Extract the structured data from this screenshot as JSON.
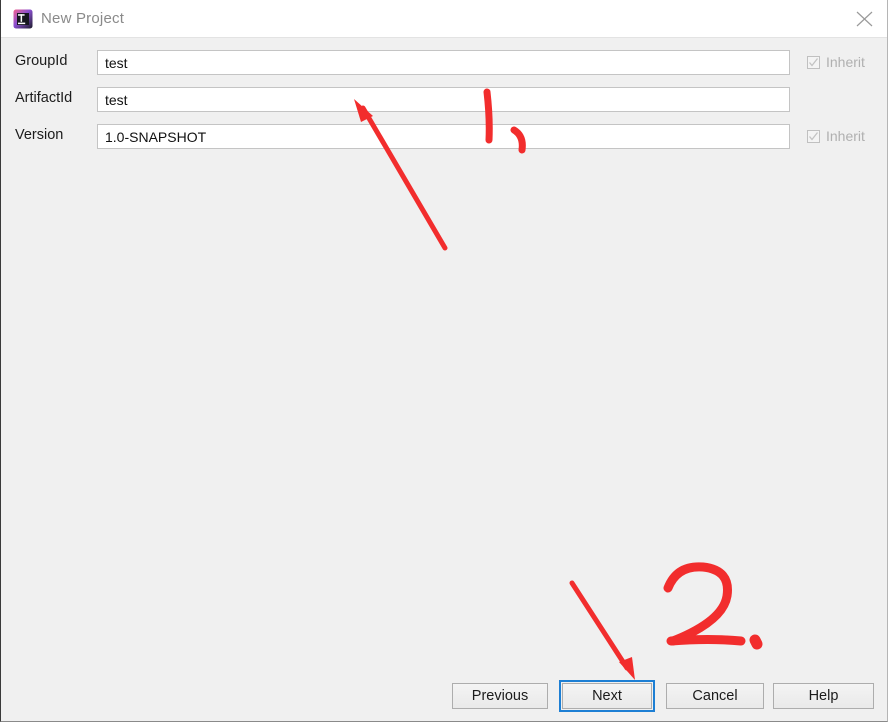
{
  "window": {
    "title": "New Project",
    "icon": "intellij-idea-icon",
    "close_icon": "close-icon",
    "background_color": "#f0f0f0",
    "titlebar_color": "#ffffff"
  },
  "form": {
    "rows": [
      {
        "label": "GroupId",
        "value": "test",
        "placeholder": "",
        "inherit": {
          "label": "Inherit",
          "checked": true,
          "enabled": false
        }
      },
      {
        "label": "ArtifactId",
        "value": "test",
        "placeholder": "",
        "inherit": null
      },
      {
        "label": "Version",
        "value": "1.0-SNAPSHOT",
        "placeholder": "",
        "inherit": {
          "label": "Inherit",
          "checked": true,
          "enabled": false
        }
      }
    ]
  },
  "buttons": {
    "previous": "Previous",
    "next": "Next",
    "cancel": "Cancel",
    "help": "Help",
    "focused": "Next",
    "focus_color": "#1d7fd4"
  },
  "annotations": {
    "color": "#f22d2d",
    "marks": [
      {
        "name": "step-1-number",
        "text": "1."
      },
      {
        "name": "step-1-arrow",
        "text": ""
      },
      {
        "name": "step-2-number",
        "text": "2."
      },
      {
        "name": "step-2-arrow",
        "text": ""
      }
    ]
  }
}
